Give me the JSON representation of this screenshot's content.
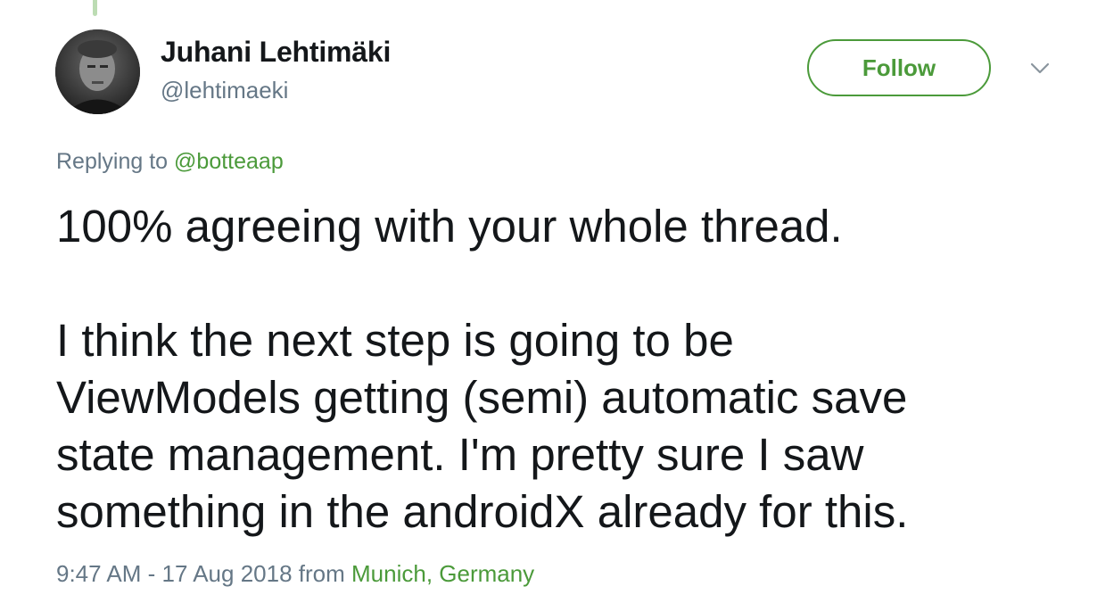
{
  "author": {
    "display_name": "Juhani Lehtimäki",
    "handle": "@lehtimaeki"
  },
  "actions": {
    "follow_label": "Follow",
    "menu_icon": "chevron-down-icon"
  },
  "reply": {
    "prefix": "Replying to ",
    "to_handle": "@botteaap"
  },
  "tweet": {
    "line_1": "100% agreeing with your whole thread.",
    "line_2": "I think the next step is going to be",
    "line_3": "ViewModels getting (semi) automatic save",
    "line_4": "state management. I'm pretty sure I saw",
    "line_5": "something in the androidX already for this."
  },
  "meta": {
    "timestamp": "9:47 AM - 17 Aug 2018",
    "from_label": " from ",
    "location": "Munich, Germany"
  },
  "colors": {
    "accent": "#4b9a3a",
    "secondary_text": "#657786",
    "primary_text": "#14171a",
    "thread_line": "#bcdcb3"
  }
}
